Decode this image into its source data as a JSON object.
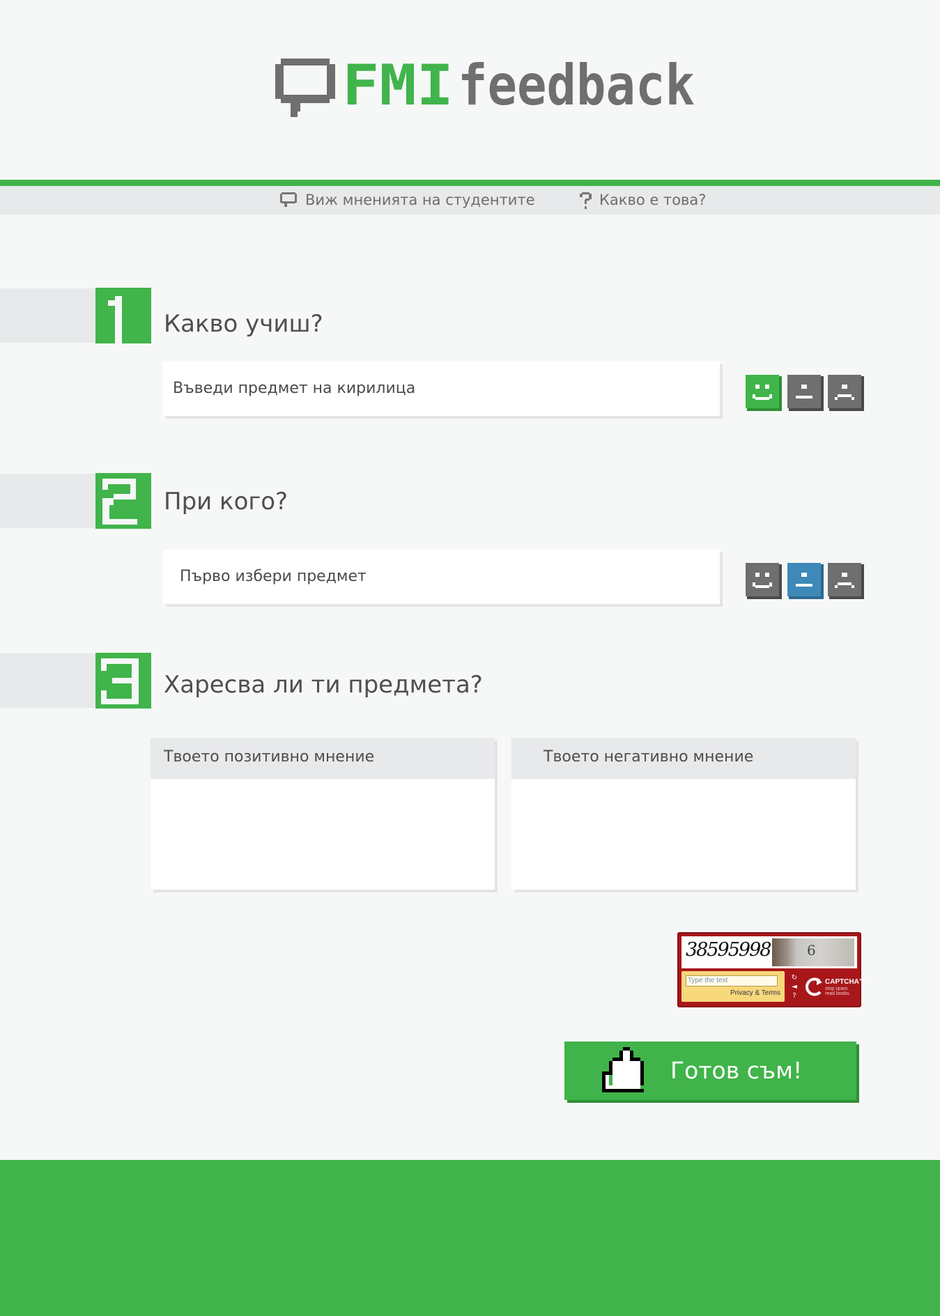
{
  "header": {
    "logo_text_primary": "FMI",
    "logo_text_secondary": "feedback",
    "logo_icon": "speech-bubble-icon"
  },
  "nav": {
    "view_opinions": "Виж мненията на студентите",
    "what_is_this": "Какво е това?"
  },
  "steps": [
    {
      "number": "1",
      "title": "Какво учиш?",
      "placeholder": "Въведи предмет на кирилица",
      "rating": "happy"
    },
    {
      "number": "2",
      "title": "При кого?",
      "placeholder": "Първо избери предмет",
      "rating": "neutral"
    },
    {
      "number": "3",
      "title": "Харесва ли ти предмета?"
    }
  ],
  "opinions": {
    "positive_label": "Твоето позитивно мнение",
    "negative_label": "Твоето негативно мнение"
  },
  "captcha": {
    "code": "38595998",
    "number": "6",
    "input_placeholder": "Type the text",
    "privacy": "Privacy & Terms",
    "brand": "CAPTCHA™",
    "tagline": "stop spam. read books."
  },
  "submit": {
    "label": "Готов съм!",
    "icon": "thumbs-up-icon"
  },
  "colors": {
    "brand_green": "#41b44b",
    "neutral_gray": "#6f6f6f",
    "selected_blue": "#3e89b8",
    "captcha_red": "#a7171a"
  }
}
